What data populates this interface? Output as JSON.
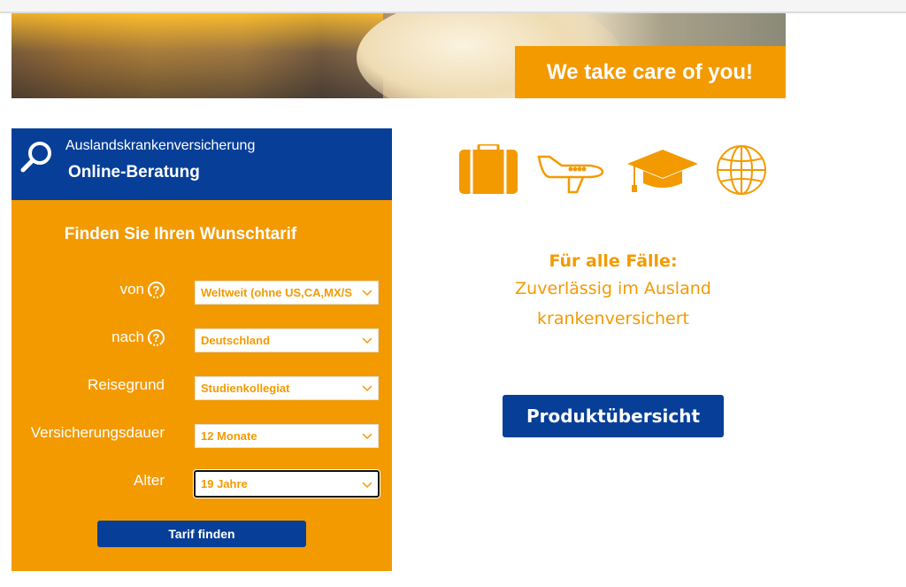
{
  "hero": {
    "tagline": "We take care of you!"
  },
  "panel": {
    "header_small": "Auslandskrankenversicherung",
    "header_big": "Online-Beratung",
    "form_title": "Finden Sie Ihren Wunschtarif",
    "rows": [
      {
        "label": "von",
        "help": "?",
        "value": "Weltweit (ohne US,CA,MX/S"
      },
      {
        "label": "nach",
        "help": "?",
        "value": "Deutschland"
      },
      {
        "label": "Reisegrund",
        "value": "Studienkollegiat"
      },
      {
        "label": "Versicherungsdauer",
        "value": "12 Monate"
      },
      {
        "label": "Alter",
        "value": "19 Jahre"
      }
    ],
    "submit_label": "Tarif finden"
  },
  "icons": [
    "suitcase-icon",
    "airplane-icon",
    "graduation-cap-icon",
    "globe-icon"
  ],
  "slogan": {
    "line1": "Für alle Fälle:",
    "line2": "Zuverlässig im Ausland",
    "line3": "krankenversichert"
  },
  "product_button": "Produktübersicht",
  "colors": {
    "orange": "#f39a00",
    "blue": "#073f98"
  }
}
